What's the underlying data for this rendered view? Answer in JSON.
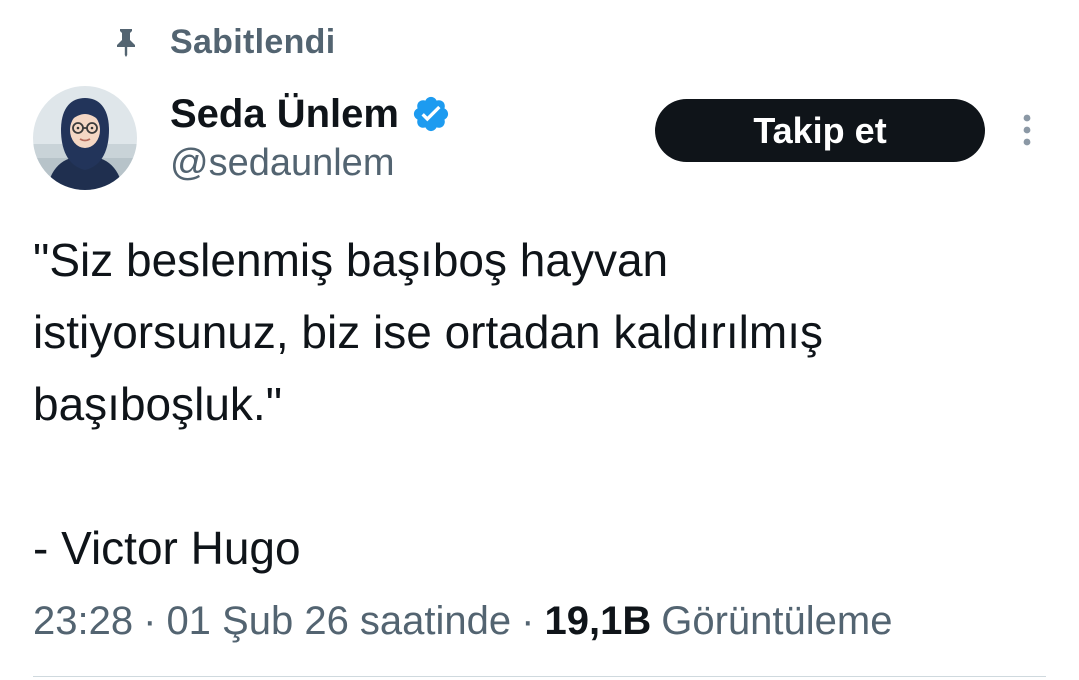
{
  "pinned": {
    "label": "Sabitlendi",
    "icon": "pin-icon"
  },
  "author": {
    "display_name": "Seda Ünlem",
    "handle": "@sedaunlem",
    "verified": true,
    "verified_color": "#1d9bf0",
    "avatar_icon": "avatar-illustration"
  },
  "actions": {
    "follow_label": "Takip et",
    "more_icon": "more-vertical-icon"
  },
  "tweet": {
    "lines": [
      "\"Siz beslenmiş başıboş hayvan",
      "istiyorsunuz, biz ise ortadan kaldırılmış",
      "başıboşluk.\"",
      "",
      "- Victor Hugo"
    ]
  },
  "meta": {
    "time": "23:28",
    "separator": "·",
    "date": "01 Şub 26 saatinde",
    "views_count": "19,1B",
    "views_label": "Görüntüleme"
  }
}
